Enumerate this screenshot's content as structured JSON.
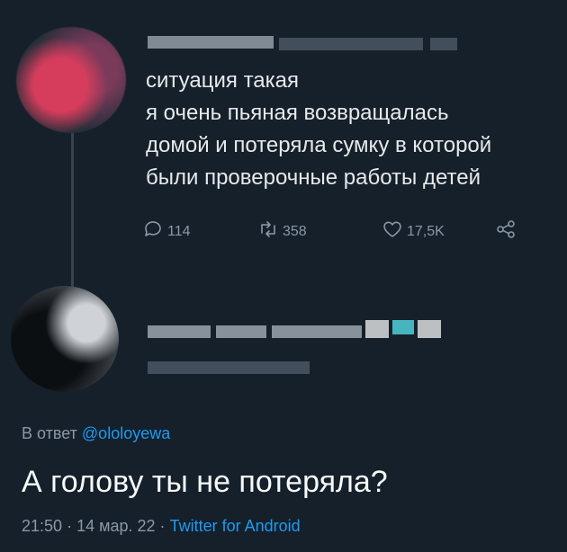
{
  "original_tweet": {
    "lines": [
      "ситуация такая",
      "я очень пьяная возвращалась",
      "домой и потеряла сумку в которой",
      "были проверочные работы детей"
    ],
    "actions": {
      "replies": "114",
      "retweets": "358",
      "likes": "17,5K"
    }
  },
  "reply": {
    "in_reply_prefix": "В ответ",
    "mention": "@ololoyewa",
    "text": "А голову ты не потеряла?",
    "time": "21:50",
    "date": "14 мар. 22",
    "source": "Twitter for Android",
    "separator": "·"
  },
  "colors": {
    "background": "#15202b",
    "link": "#1d9bf0",
    "secondary": "#8b98a5"
  }
}
